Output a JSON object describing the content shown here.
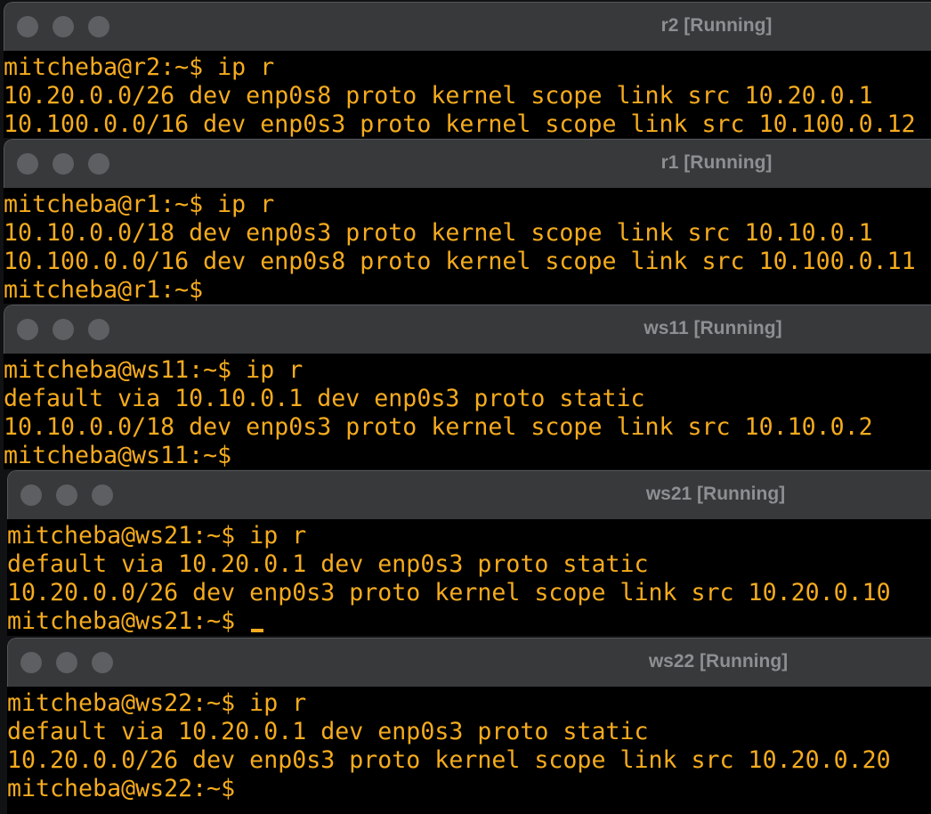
{
  "windows": [
    {
      "title": "r2 [Running]",
      "lines": [
        "mitcheba@r2:~$ ip r",
        "10.20.0.0/26 dev enp0s8 proto kernel scope link src 10.20.0.1",
        "10.100.0.0/16 dev enp0s3 proto kernel scope link src 10.100.0.12"
      ]
    },
    {
      "title": "r1 [Running]",
      "lines": [
        "mitcheba@r1:~$ ip r",
        "10.10.0.0/18 dev enp0s3 proto kernel scope link src 10.10.0.1",
        "10.100.0.0/16 dev enp0s8 proto kernel scope link src 10.100.0.11",
        "mitcheba@r1:~$"
      ]
    },
    {
      "title": "ws11 [Running]",
      "lines": [
        "mitcheba@ws11:~$ ip r",
        "default via 10.10.0.1 dev enp0s3 proto static",
        "10.10.0.0/18 dev enp0s3 proto kernel scope link src 10.10.0.2",
        "mitcheba@ws11:~$"
      ]
    },
    {
      "title": "ws21 [Running]",
      "lines": [
        "mitcheba@ws21:~$ ip r",
        "default via 10.20.0.1 dev enp0s3 proto static",
        "10.20.0.0/26 dev enp0s3 proto kernel scope link src 10.20.0.10",
        "mitcheba@ws21:~$ "
      ]
    },
    {
      "title": "ws22 [Running]",
      "lines": [
        "mitcheba@ws22:~$ ip r",
        "default via 10.20.0.1 dev enp0s3 proto static",
        "10.20.0.0/26 dev enp0s3 proto kernel scope link src 10.20.0.20",
        "mitcheba@ws22:~$"
      ]
    }
  ],
  "colors": {
    "terminal_text": "#f5ab1e",
    "terminal_bg": "#000000",
    "titlebar_bg": "#38393b",
    "title_text": "#8e8f92",
    "window_button": "#5e5f62"
  },
  "icons": [
    "close-button-icon",
    "minimize-button-icon",
    "zoom-button-icon",
    "terminal-cursor"
  ]
}
